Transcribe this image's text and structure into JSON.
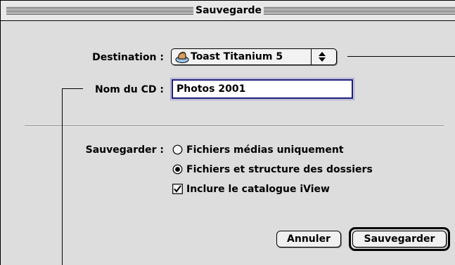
{
  "window": {
    "title": "Sauvegarde"
  },
  "form": {
    "destination_label": "Destination :",
    "destination_value": "Toast Titanium 5",
    "cd_name_label": "Nom du CD :",
    "cd_name_value": "Photos 2001",
    "save_label": "Sauvegarder :",
    "options": [
      {
        "label": "Fichiers médias uniquement",
        "type": "radio",
        "selected": false
      },
      {
        "label": "Fichiers et structure des dossiers",
        "type": "radio",
        "selected": true
      },
      {
        "label": "Inclure le catalogue iView",
        "type": "checkbox",
        "checked": true
      }
    ]
  },
  "buttons": {
    "cancel": "Annuler",
    "save": "Sauvegarder"
  },
  "icons": {
    "destination": "toast-cd-icon",
    "popup_arrows": "up-down-arrows-icon"
  }
}
